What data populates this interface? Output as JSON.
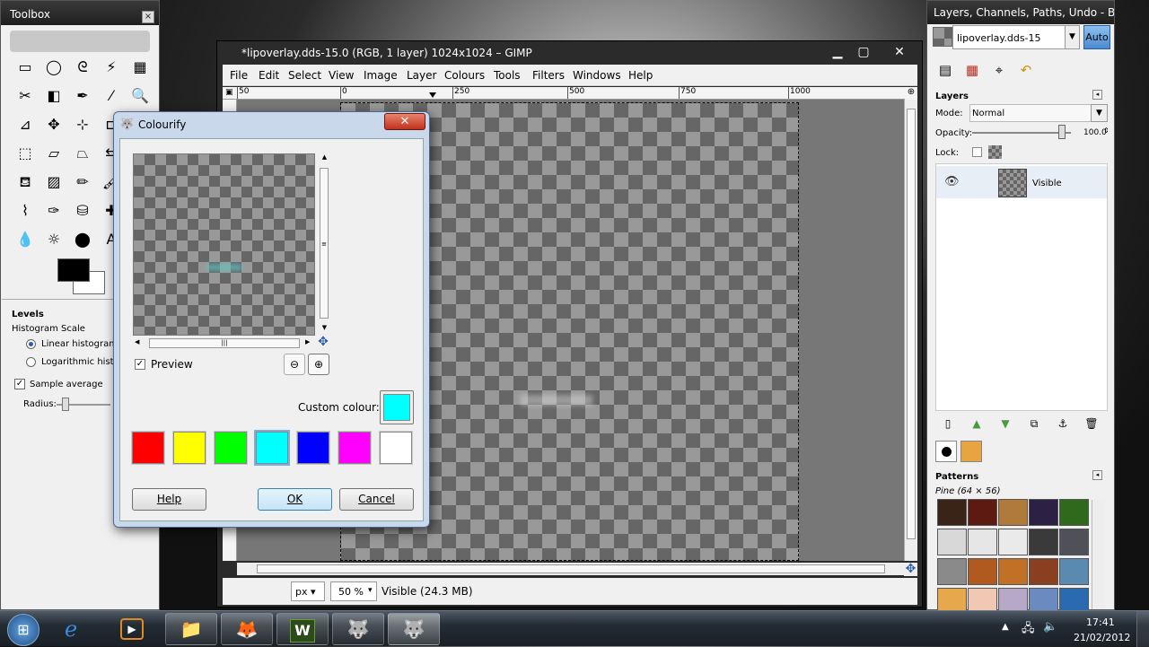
{
  "toolbox": {
    "title": "Toolbox",
    "close": "×",
    "tools": [
      {
        "name": "rect-select-icon",
        "glyph": "▭"
      },
      {
        "name": "ellipse-select-icon",
        "glyph": "◯"
      },
      {
        "name": "free-select-icon",
        "glyph": "ᘓ"
      },
      {
        "name": "fuzzy-select-icon",
        "glyph": "⚡"
      },
      {
        "name": "select-by-color-icon",
        "glyph": "▦"
      },
      {
        "name": "scissors-icon",
        "glyph": "✂"
      },
      {
        "name": "foreground-select-icon",
        "glyph": "◧"
      },
      {
        "name": "paths-icon",
        "glyph": "✒"
      },
      {
        "name": "color-picker-icon",
        "glyph": "⁄"
      },
      {
        "name": "zoom-icon",
        "glyph": "🔍"
      },
      {
        "name": "measure-icon",
        "glyph": "⊿"
      },
      {
        "name": "move-icon",
        "glyph": "✥"
      },
      {
        "name": "align-icon",
        "glyph": "⊹"
      },
      {
        "name": "crop-icon",
        "glyph": "⊏"
      },
      {
        "name": "rotate-icon",
        "glyph": "↻"
      },
      {
        "name": "scale-icon",
        "glyph": "⬚"
      },
      {
        "name": "shear-icon",
        "glyph": "▱"
      },
      {
        "name": "perspective-icon",
        "glyph": "⏢"
      },
      {
        "name": "flip-icon",
        "glyph": "⇆"
      },
      {
        "name": "cage-icon",
        "glyph": "⬠"
      },
      {
        "name": "bucket-fill-icon",
        "glyph": "⛾"
      },
      {
        "name": "blend-icon",
        "glyph": "▨"
      },
      {
        "name": "pencil-icon",
        "glyph": "✏"
      },
      {
        "name": "paintbrush-icon",
        "glyph": "🖌"
      },
      {
        "name": "eraser-icon",
        "glyph": "▰"
      },
      {
        "name": "airbrush-icon",
        "glyph": "⌇"
      },
      {
        "name": "ink-icon",
        "glyph": "✑"
      },
      {
        "name": "clone-icon",
        "glyph": "⛁"
      },
      {
        "name": "heal-icon",
        "glyph": "✚"
      },
      {
        "name": "smudge-icon",
        "glyph": "☝"
      },
      {
        "name": "blur-icon",
        "glyph": "💧"
      },
      {
        "name": "dodge-burn-icon",
        "glyph": "☼"
      },
      {
        "name": "smudge-tool-icon",
        "glyph": "⬤"
      },
      {
        "name": "text-icon",
        "glyph": "A"
      },
      {
        "name": "unused-icon",
        "glyph": ""
      }
    ],
    "options_title": "Levels",
    "histogram_scale": "Histogram Scale",
    "linear": "Linear histogram",
    "logarithmic": "Logarithmic histog",
    "sample_average": "Sample average",
    "radius": "Radius:"
  },
  "gimp": {
    "title": "*lipoverlay.dds-15.0 (RGB, 1 layer) 1024x1024 – GIMP",
    "menu": [
      "File",
      "Edit",
      "Select",
      "View",
      "Image",
      "Layer",
      "Colours",
      "Tools",
      "Filters",
      "Windows",
      "Help"
    ],
    "ruler": [
      "50",
      "0",
      "250",
      "500",
      "750",
      "1000"
    ],
    "unit": "px",
    "zoom": "50 %",
    "status": "Visible (24.3 MB)"
  },
  "dock": {
    "title": "Layers, Channels, Paths, Undo - B...",
    "image_name": "lipoverlay.dds-15",
    "auto": "Auto",
    "panel_title": "Layers",
    "mode_label": "Mode:",
    "mode_value": "Normal",
    "opacity_label": "Opacity:",
    "opacity_value": "100.0",
    "lock_label": "Lock:",
    "layer_name": "Visible",
    "patterns_title": "Patterns",
    "pattern_name": "Pine (64 × 56)",
    "pattern_colors": [
      "#3a2418",
      "#5c1a10",
      "#b07a3a",
      "#2c2144",
      "#2f6a1c",
      "#d8d8d8",
      "#e6e6e6",
      "#eaeaea",
      "#3a3a3a",
      "#505058",
      "#8a8a8a",
      "#b05a20",
      "#c27026",
      "#8a4020",
      "#5a8ab0",
      "#e6a84a",
      "#f0c8b4",
      "#b8a8c8",
      "#6a8ac0",
      "#2a6ab0"
    ]
  },
  "dialog": {
    "title": "Colourify",
    "close": "✕",
    "preview_label": "Preview",
    "custom_colour_label": "Custom colour:",
    "custom_colour": "#00ffff",
    "swatches": [
      "#ff0000",
      "#ffff00",
      "#00ff00",
      "#00ffff",
      "#0000ff",
      "#ff00ff",
      "#ffffff"
    ],
    "help": "Help",
    "ok": "OK",
    "cancel": "Cancel"
  },
  "taskbar": {
    "time": "17:41",
    "date": "21/02/2012"
  }
}
